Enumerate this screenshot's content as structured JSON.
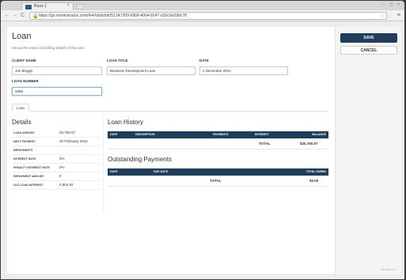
{
  "browser": {
    "tab_title": "Ruvo 1",
    "tab_close": "×",
    "url": "https://go.moneytracks.com/lo4/#/job/sdr/521A7309-69b8-4064-8147-d10c9e2dbc78",
    "lock": "🔒",
    "star": "☆",
    "back": "←",
    "forward": "→",
    "reload": "C",
    "menu": "≡",
    "window_controls": "– ▢ ×"
  },
  "page": {
    "title": "Loan",
    "subtitle": "Set up the name and billing details of the loan",
    "fields": {
      "client_name_label": "CLIENT NAME",
      "client_name_value": "Joe Bloggs",
      "loan_title_label": "LOAN TITLE",
      "loan_title_value": "Business Development Loan",
      "date_label": "DATE",
      "date_value": "1 December 2012",
      "loan_number_label": "LOAN NUMBER",
      "loan_number_value": "0058"
    },
    "tab_loan": "Loan"
  },
  "details": {
    "heading": "Details",
    "rows": [
      {
        "label": "LOAN AMOUNT",
        "value": "20,760.07"
      },
      {
        "label": "NEXT PAYMENT",
        "value": "20 February 2015"
      },
      {
        "label": "REPAYMENTS",
        "value": ""
      },
      {
        "label": "INTEREST RATE",
        "value": "0%"
      },
      {
        "label": "PENALTY INTEREST RATE",
        "value": "0%"
      },
      {
        "label": "REPAYMENT AMOUNT",
        "value": "0"
      },
      {
        "label": "OLD LOAN INTEREST",
        "value": "4,504.82"
      }
    ]
  },
  "loan_history": {
    "heading": "Loan History",
    "columns": [
      "DATE",
      "DESCRIPTION",
      "PAYMENTS",
      "INTEREST",
      "BALANCE"
    ],
    "total_label": "TOTAL",
    "total_value": "$20,760.07"
  },
  "outstanding": {
    "heading": "Outstanding Payments",
    "columns": [
      "DATE",
      "DUE DATE",
      "TOTAL OWING"
    ],
    "total_label": "TOTAL",
    "total_value": "$0.00"
  },
  "sidebar": {
    "save": "SAVE",
    "cancel": "CANCEL",
    "footer": "Version 2.0"
  }
}
